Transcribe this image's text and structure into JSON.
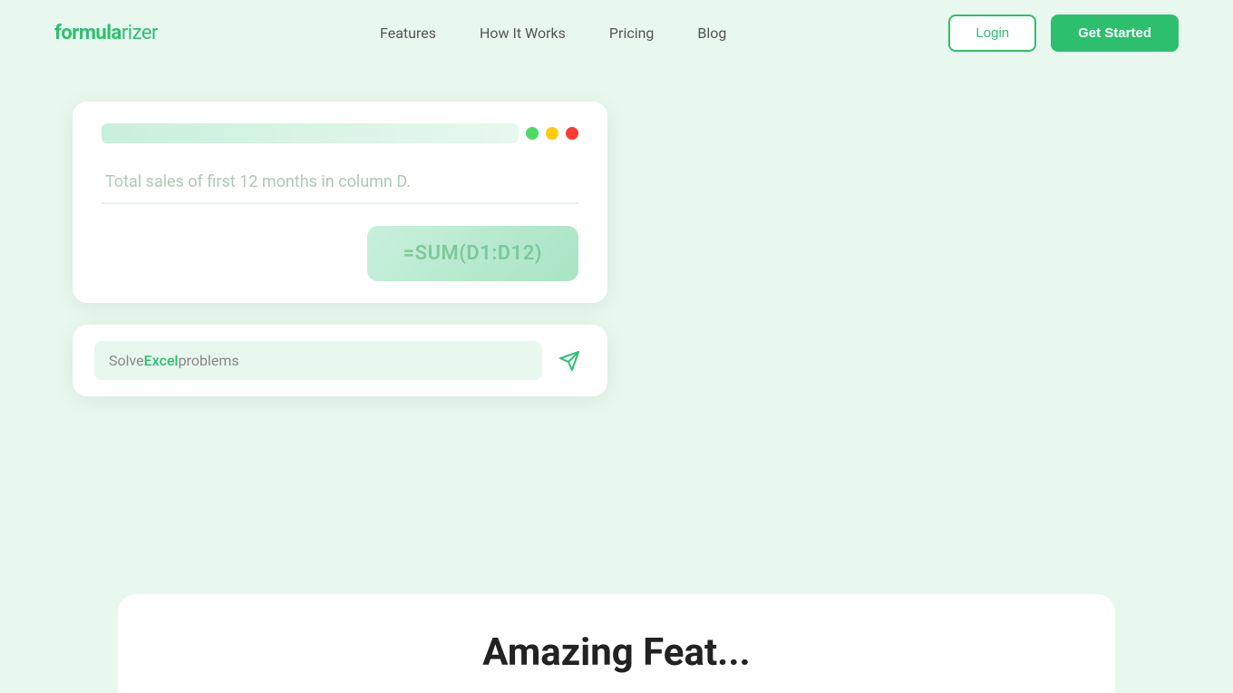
{
  "logo": {
    "formula": "formula",
    "rizer": "rizer",
    "full": "formularizer"
  },
  "nav": {
    "links": [
      {
        "label": "Features",
        "id": "features"
      },
      {
        "label": "How It Works",
        "id": "how-it-works"
      },
      {
        "label": "Pricing",
        "id": "pricing"
      },
      {
        "label": "Blog",
        "id": "blog"
      }
    ],
    "login_label": "Login",
    "get_started_label": "Get Started"
  },
  "hero_card": {
    "input_placeholder": "Total sales of first 12 months in column D.",
    "formula_output": "=SUM(D1:D12)"
  },
  "search_card": {
    "placeholder_solve": "Solve ",
    "placeholder_excel": "Excel",
    "placeholder_problems": " problems"
  },
  "bottom_section": {
    "title": "Amazing Feat..."
  },
  "icons": {
    "send": "✈"
  }
}
